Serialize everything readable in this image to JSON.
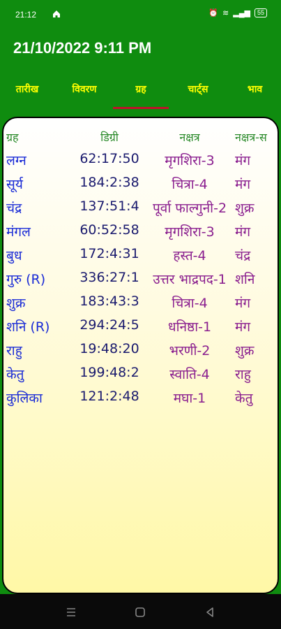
{
  "status": {
    "time": "21:12",
    "battery": "55"
  },
  "header": {
    "date": "21/10/2022 9:11 PM"
  },
  "tabs": [
    "तारीख",
    "विवरण",
    "ग्रह",
    "चार्ट्स",
    "भाव"
  ],
  "table": {
    "columns": [
      "ग्रह",
      "डिग्री",
      "नक्षत्र",
      "नक्षत्र-स"
    ],
    "rows": [
      [
        "लग्न",
        "62:17:50",
        "मृगशिरा-3",
        "मंग"
      ],
      [
        "सूर्य",
        "184:2:38",
        "चित्रा-4",
        "मंग"
      ],
      [
        "चंद्र",
        "137:51:4",
        "पूर्वा फाल्गुनी-2",
        "शुक्र"
      ],
      [
        "मंगल",
        "60:52:58",
        "मृगशिरा-3",
        "मंग"
      ],
      [
        "बुध",
        "172:4:31",
        "हस्त-4",
        "चंद्र"
      ],
      [
        "गुरु (R)",
        "336:27:1",
        "उत्तर भाद्रपद-1",
        "शनि"
      ],
      [
        "शुक्र",
        "183:43:3",
        "चित्रा-4",
        "मंग"
      ],
      [
        "शनि (R)",
        "294:24:5",
        "धनिष्ठा-1",
        "मंग"
      ],
      [
        "राहु",
        "19:48:20",
        "भरणी-2",
        "शुक्र"
      ],
      [
        "केतु",
        "199:48:2",
        "स्वाति-4",
        "राहु"
      ],
      [
        "कुलिका",
        "121:2:48",
        "मघा-1",
        "केतु"
      ]
    ]
  },
  "colors": {
    "green": "#0f8c0f",
    "tab": "#ffff00",
    "indicator": "#c0122a"
  }
}
